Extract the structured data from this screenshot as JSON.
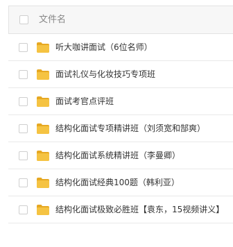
{
  "header": {
    "column_label": "文件名"
  },
  "colors": {
    "folder": "#f5c342",
    "folder_dark": "#e6a822",
    "border": "#e9e9e9",
    "header_bg": "#f7f7f7"
  },
  "files": [
    {
      "name": "听大咖讲面试（6位名师）",
      "icon": "folder-icon"
    },
    {
      "name": "面试礼仪与化妆技巧专项班",
      "icon": "folder-icon"
    },
    {
      "name": "面试考官点评班",
      "icon": "folder-icon"
    },
    {
      "name": "结构化面试专项精讲班（刘须宽和郜爽）",
      "icon": "folder-icon"
    },
    {
      "name": "结构化面试系统精讲班（李曼卿）",
      "icon": "folder-icon"
    },
    {
      "name": "结构化面试经典100题（韩利亚）",
      "icon": "folder-icon"
    },
    {
      "name": "结构化面试极致必胜班【袁东，15视频讲义】",
      "icon": "folder-icon"
    }
  ]
}
